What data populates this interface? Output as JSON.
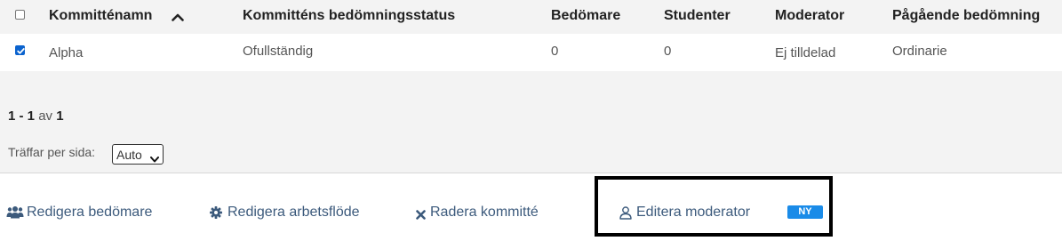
{
  "table": {
    "columns": [
      "Kommitténamn",
      "Kommitténs bedömningsstatus",
      "Bedömare",
      "Studenter",
      "Moderator",
      "Pågående bedömning"
    ],
    "rows": [
      {
        "checked": true,
        "name": "Alpha",
        "status": "Ofullständig",
        "assessors": "0",
        "students": "0",
        "moderator": "Ej tilldelad",
        "ongoing": "Ordinarie"
      }
    ],
    "sort_icon": "chevron-up-icon"
  },
  "pagination": {
    "range": "1 - 1",
    "of_label": "av",
    "total": "1"
  },
  "per_page": {
    "label": "Träffar per sida:",
    "selected": "Auto"
  },
  "actions": {
    "edit_assessors": {
      "label": "Redigera bedömare",
      "icon": "users-icon"
    },
    "edit_workflow": {
      "label": "Redigera arbetsflöde",
      "icon": "gear-icon"
    },
    "delete_committee": {
      "label": "Radera kommitté",
      "icon": "close-icon"
    },
    "edit_moderator": {
      "label": "Editera moderator",
      "icon": "user-icon",
      "badge": "NY"
    }
  },
  "colors": {
    "link": "#3c5a7c",
    "badge": "#1a8be8",
    "checkbox": "#0b63ce"
  }
}
